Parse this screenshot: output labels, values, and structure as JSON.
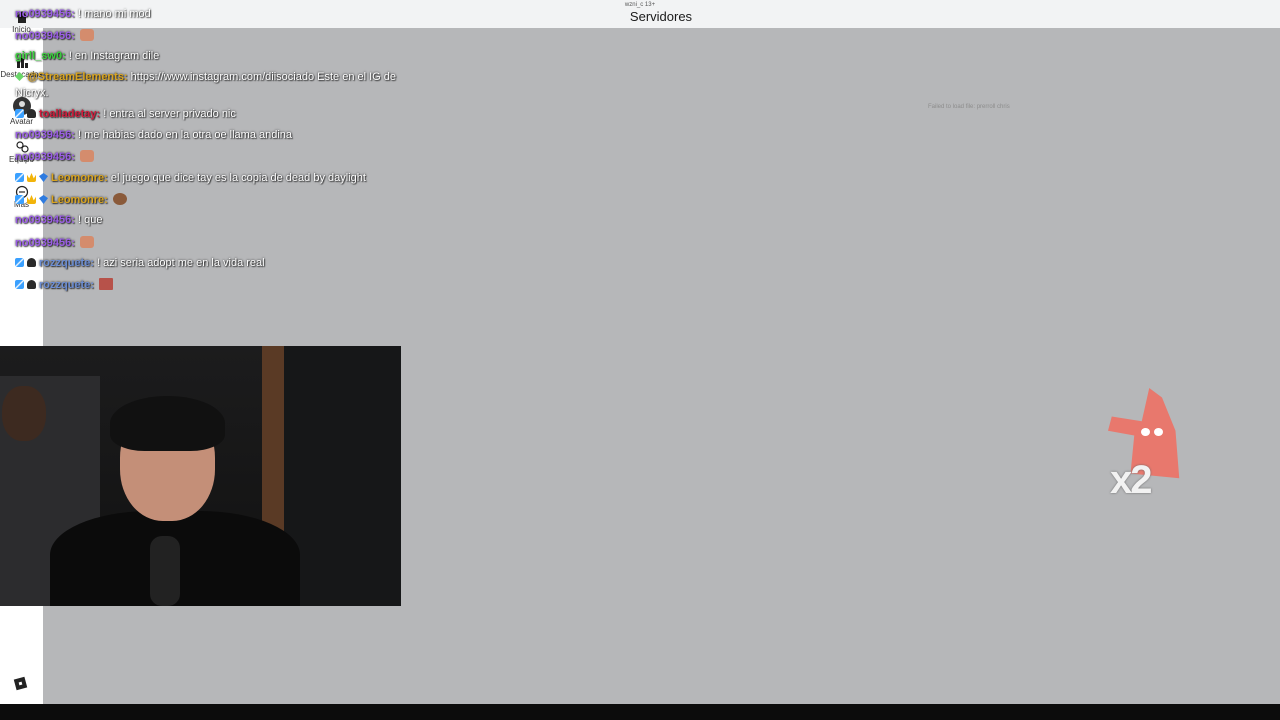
{
  "topbar": {
    "user": "wzni_c 13+",
    "title": "Servidores"
  },
  "sidebar": {
    "items": [
      {
        "icon": "home-icon",
        "label": "Inicio"
      },
      {
        "icon": "charts-icon",
        "label": "Destacados"
      },
      {
        "icon": "avatar-icon",
        "label": "Avatar"
      },
      {
        "icon": "party-icon",
        "label": "Equipo"
      },
      {
        "icon": "chat-icon",
        "label": "Más"
      }
    ],
    "logo_icon": "roblox-logo-icon"
  },
  "game": {
    "failed_text": "Failed to load file: prerroll chris"
  },
  "chat": [
    {
      "user": "no0939456:",
      "text": "! mano mi mod",
      "color": "#9b5ee6"
    },
    {
      "user": "no0939456:",
      "text": "",
      "color": "#9b5ee6"
    },
    {
      "user": "girll_sw0:",
      "text": "! en Instagram dile",
      "color": "#39d13c"
    },
    {
      "user": "@StreamElements:",
      "text": "https://www.instagram.com/diisociado Este en el IG de Nicryx.",
      "color": "#daa520"
    },
    {
      "user": "toalladetay:",
      "text": "! entra al server privado nic",
      "color": "#d11c3c"
    },
    {
      "user": "no0939456:",
      "text": "! me habias dado en la otra oe llama andina",
      "color": "#9b5ee6"
    },
    {
      "user": "no0939456:",
      "text": "",
      "color": "#9b5ee6"
    },
    {
      "user": "Leomonre:",
      "text": "el juego que dice tay es la copia de dead by daylight",
      "color": "#daa520"
    },
    {
      "user": "Leomonre:",
      "text": "",
      "color": "#daa520"
    },
    {
      "user": "no0939456:",
      "text": "! que",
      "color": "#9b5ee6"
    },
    {
      "user": "no0939456:",
      "text": "",
      "color": "#9b5ee6"
    },
    {
      "user": "rozzquete:",
      "text": "! azi seria adopt me en la vida real",
      "color": "#6c8ed4"
    },
    {
      "user": "rozzquete:",
      "text": "",
      "color": "#6c8ed4"
    }
  ],
  "sticker": {
    "multiplier": "x2"
  }
}
